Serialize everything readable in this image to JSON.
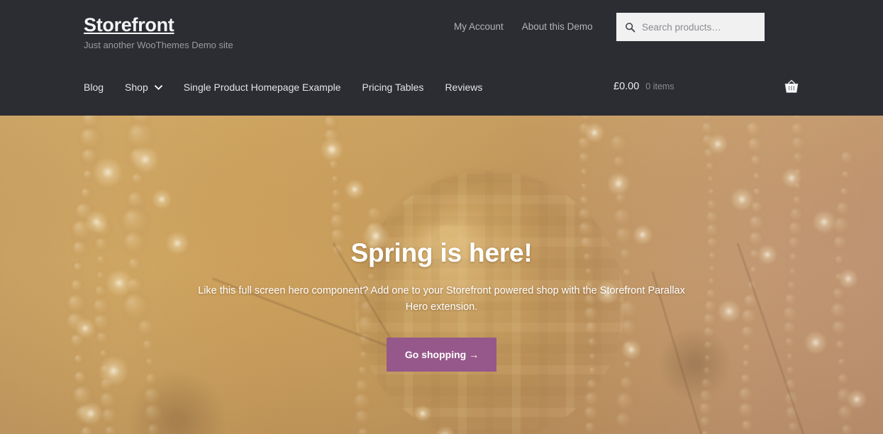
{
  "branding": {
    "site_title": "Storefront",
    "site_description": "Just another WooThemes Demo site"
  },
  "secondary_nav": {
    "items": [
      {
        "label": "My Account"
      },
      {
        "label": "About this Demo"
      }
    ]
  },
  "search": {
    "placeholder": "Search products…",
    "value": "",
    "icon": "search-icon"
  },
  "main_nav": {
    "items": [
      {
        "label": "Blog",
        "has_dropdown": false
      },
      {
        "label": "Shop",
        "has_dropdown": true,
        "dropdown_icon": "chevron-down-icon"
      },
      {
        "label": "Single Product Homepage Example",
        "has_dropdown": false
      },
      {
        "label": "Pricing Tables",
        "has_dropdown": false
      },
      {
        "label": "Reviews",
        "has_dropdown": false
      }
    ]
  },
  "cart": {
    "amount": "£0.00",
    "count": "0 items",
    "icon": "shopping-basket-icon"
  },
  "hero": {
    "title": "Spring is here!",
    "text": "Like this full screen hero component? Add one to your Storefront powered shop with the Storefront Parallax Hero extension.",
    "button_label": "Go shopping →",
    "image_description": "Blurred golden chandelier with glass sphere and strands of crystal beads"
  },
  "colors": {
    "header_background": "#2c2d33",
    "accent_purple": "#96588a",
    "search_background": "#f1f1f1",
    "muted_text": "#b2b3b8",
    "hero_gold": "#c9a061"
  }
}
